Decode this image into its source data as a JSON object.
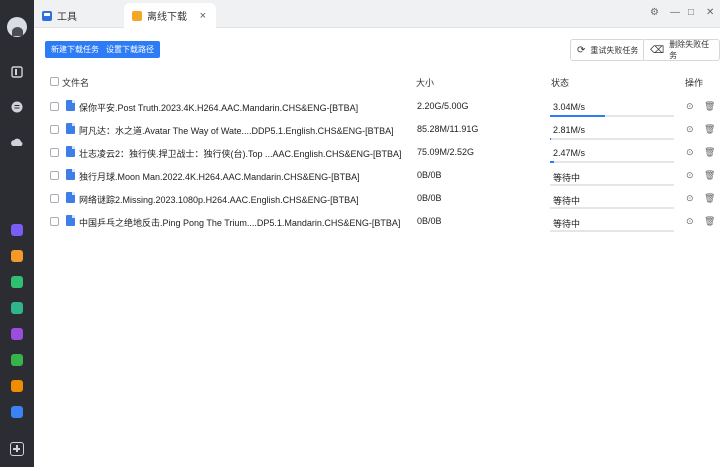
{
  "tabs": {
    "tools": "工具",
    "offline": "离线下载",
    "close": "×"
  },
  "window": {
    "settings": "⚙",
    "minimize": "—",
    "maximize": "□",
    "close": "✕"
  },
  "toolbar": {
    "new_task": "新建下载任务",
    "set_path": "设置下载路径",
    "retry_failed": "重试失败任务",
    "delete_failed": "删除失败任务"
  },
  "table": {
    "headers": {
      "name": "文件名",
      "size": "大小",
      "status": "状态",
      "actions": "操作"
    },
    "rows": [
      {
        "name": "保你平安.Post Truth.2023.4K.H264.AAC.Mandarin.CHS&ENG-[BTBA]",
        "size": "2.20G/5.00G",
        "status": "3.04M/s",
        "progress": 44
      },
      {
        "name": "阿凡达：水之道.Avatar The Way of Wate....DDP5.1.English.CHS&ENG-[BTBA]",
        "size": "85.28M/11.91G",
        "status": "2.81M/s",
        "progress": 1
      },
      {
        "name": "壮志凌云2：独行侠.捍卫战士：独行侠(台).Top ...AAC.English.CHS&ENG-[BTBA]",
        "size": "75.09M/2.52G",
        "status": "2.47M/s",
        "progress": 3
      },
      {
        "name": "独行月球.Moon Man.2022.4K.H264.AAC.Mandarin.CHS&ENG-[BTBA]",
        "size": "0B/0B",
        "status": "等待中",
        "progress": 0
      },
      {
        "name": "网络谜踪2.Missing.2023.1080p.H264.AAC.English.CHS&ENG-[BTBA]",
        "size": "0B/0B",
        "status": "等待中",
        "progress": 0
      },
      {
        "name": "中国乒乓之绝地反击.Ping Pong The Trium....DP5.1.Mandarin.CHS&ENG-[BTBA]",
        "size": "0B/0B",
        "status": "等待中",
        "progress": 0
      }
    ]
  },
  "icons": {
    "retry": "⟳",
    "delete": "⌫",
    "pause": "⊙",
    "trash": "🗑"
  },
  "colors": {
    "accent": "#2d7cf6",
    "sidebar": "#2b2d33"
  }
}
